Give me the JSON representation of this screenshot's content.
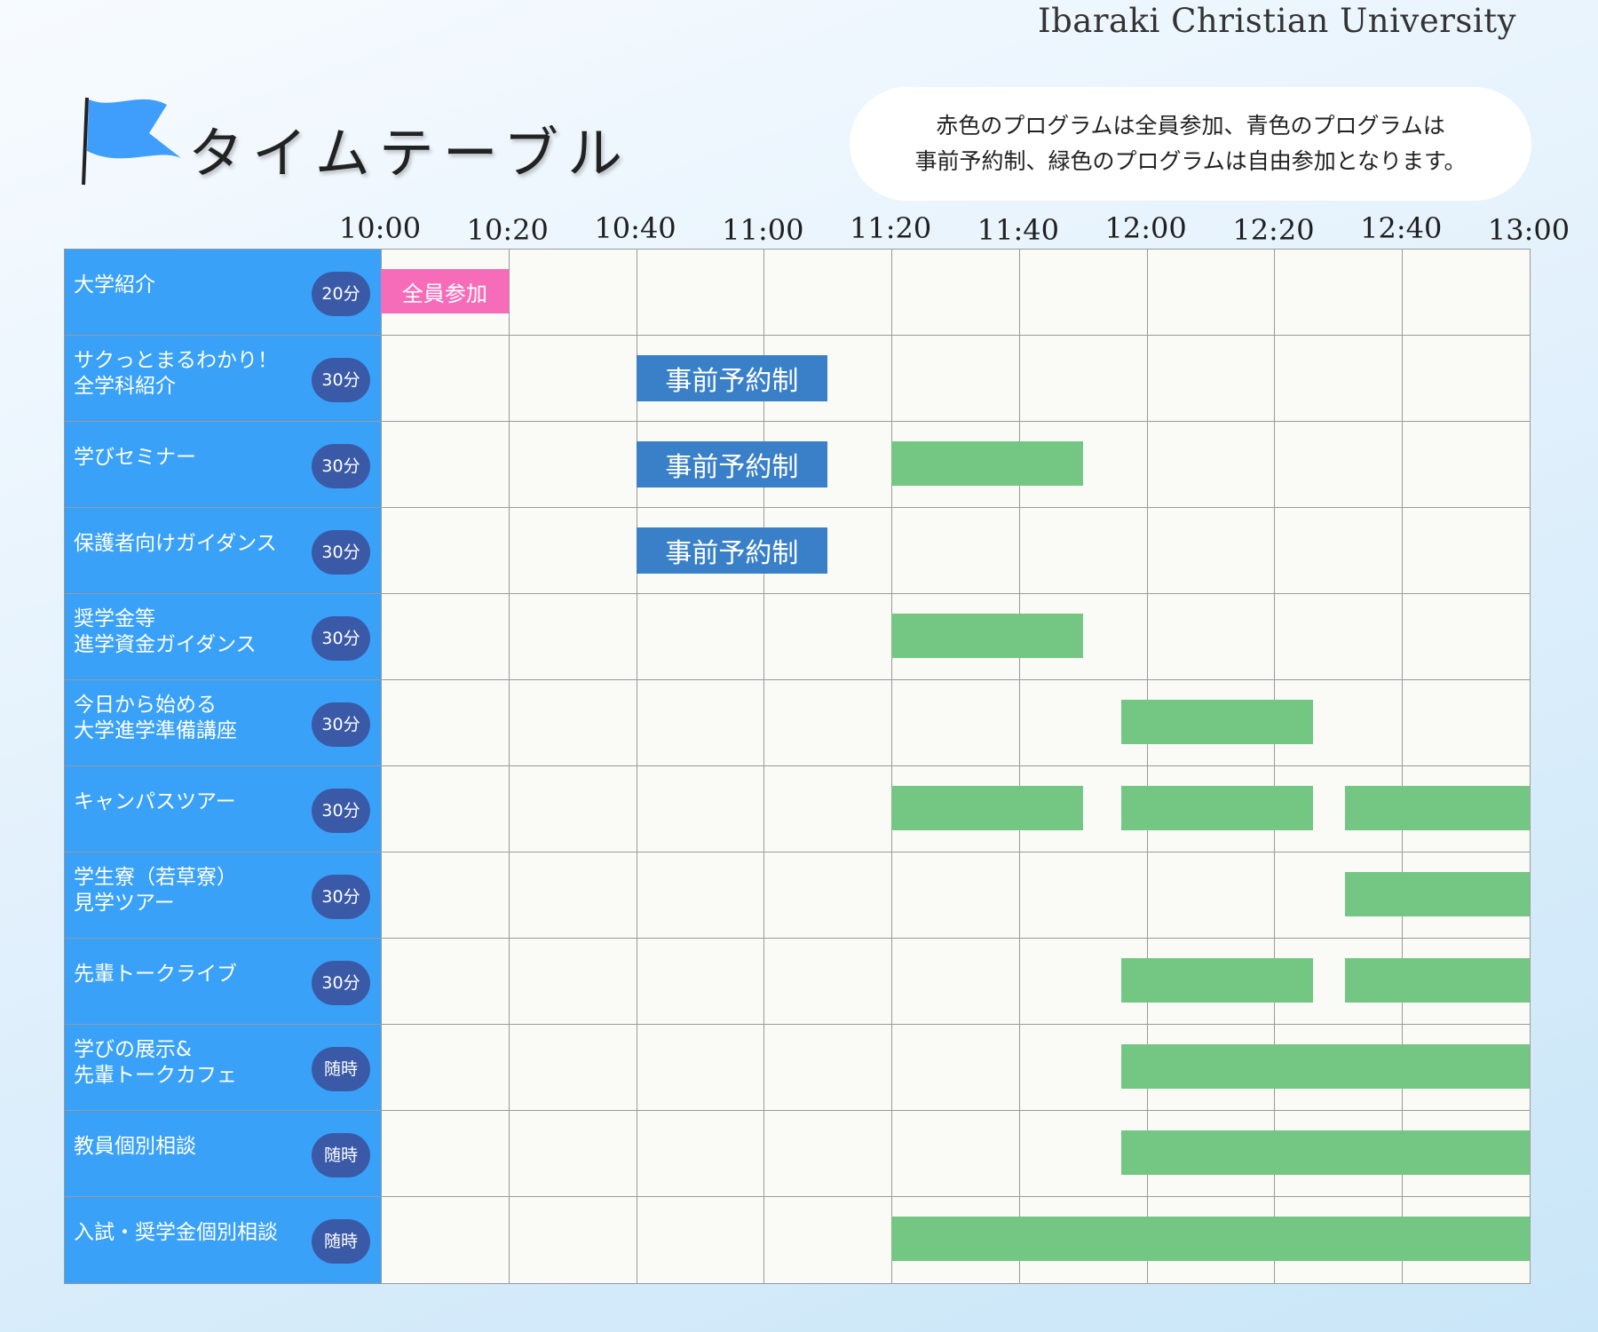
{
  "header": {
    "university": "Ibaraki Christian University",
    "title": "タイムテーブル",
    "flag_color": "#3f9efc",
    "notice_line1": "赤色のプログラムは全員参加、青色のプログラムは",
    "notice_line2": "事前予約制、緑色のプログラムは自由参加となります。"
  },
  "colors": {
    "all_participation": "#f76cb9",
    "reservation": "#3a80c9",
    "free": "#73c783",
    "label_bg": "#3aa1f8",
    "badge_bg": "#3a5aa8"
  },
  "time_labels": [
    "10:00",
    "10:20",
    "10:40",
    "11:00",
    "11:20",
    "11:40",
    "12:00",
    "12:20",
    "12:40",
    "13:00"
  ],
  "time_range": {
    "start_min": 600,
    "end_min": 780
  },
  "programs": [
    {
      "name": "大学紹介",
      "duration": "20分",
      "events": [
        {
          "type": "all",
          "label": "全員参加",
          "start": "10:00",
          "end": "10:20"
        }
      ]
    },
    {
      "name": "サクっとまるわかり！\n全学科紹介",
      "duration": "30分",
      "events": [
        {
          "type": "reserved",
          "label": "事前予約制",
          "start": "10:40",
          "end": "11:10"
        }
      ]
    },
    {
      "name": "学びセミナー",
      "duration": "30分",
      "events": [
        {
          "type": "reserved",
          "label": "事前予約制",
          "start": "10:40",
          "end": "11:10"
        },
        {
          "type": "free",
          "start": "11:20",
          "end": "11:50"
        }
      ]
    },
    {
      "name": "保護者向けガイダンス",
      "duration": "30分",
      "events": [
        {
          "type": "reserved",
          "label": "事前予約制",
          "start": "10:40",
          "end": "11:10"
        }
      ]
    },
    {
      "name": "奨学金等\n進学資金ガイダンス",
      "duration": "30分",
      "events": [
        {
          "type": "free",
          "start": "11:20",
          "end": "11:50"
        }
      ]
    },
    {
      "name": "今日から始める\n大学進学準備講座",
      "duration": "30分",
      "events": [
        {
          "type": "free",
          "start": "11:56",
          "end": "12:26"
        }
      ]
    },
    {
      "name": "キャンパスツアー",
      "duration": "30分",
      "events": [
        {
          "type": "free",
          "start": "11:20",
          "end": "11:50"
        },
        {
          "type": "free",
          "start": "11:56",
          "end": "12:26"
        },
        {
          "type": "free",
          "start": "12:31",
          "end": "13:00"
        }
      ]
    },
    {
      "name": "学生寮（若草寮）\n見学ツアー",
      "duration": "30分",
      "events": [
        {
          "type": "free",
          "start": "12:31",
          "end": "13:00"
        }
      ]
    },
    {
      "name": "先輩トークライブ",
      "duration": "30分",
      "events": [
        {
          "type": "free",
          "start": "11:56",
          "end": "12:26"
        },
        {
          "type": "free",
          "start": "12:31",
          "end": "13:00"
        }
      ]
    },
    {
      "name": "学びの展示&\n先輩トークカフェ",
      "duration": "随時",
      "events": [
        {
          "type": "free",
          "start": "11:56",
          "end": "13:00"
        }
      ]
    },
    {
      "name": "教員個別相談",
      "duration": "随時",
      "events": [
        {
          "type": "free",
          "start": "11:56",
          "end": "13:00"
        }
      ]
    },
    {
      "name": "入試・奨学金個別相談",
      "duration": "随時",
      "events": [
        {
          "type": "free",
          "start": "11:20",
          "end": "13:00"
        }
      ]
    }
  ]
}
